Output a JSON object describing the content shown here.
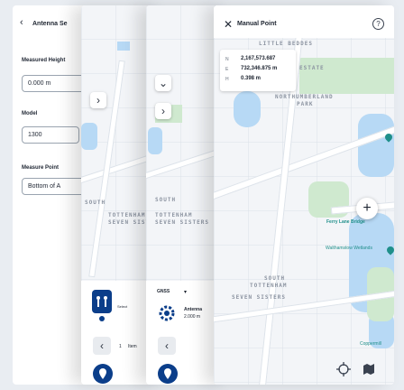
{
  "panel_a": {
    "title": "Antenna Se",
    "measured_height_label": "Measured Height",
    "measured_height_value": "0.000 m",
    "model_label": "Model",
    "model_value": "1300",
    "measure_point_label": "Measure Point",
    "measure_point_value": "Bottom of A",
    "bottom_device_label": "Select",
    "bottom_counter": "1",
    "bottom_counter_suffix": "Item"
  },
  "panel_b": {
    "map_labels": [
      "SOUTH",
      "TOTTENHAM",
      "SEVEN SISTERS"
    ]
  },
  "panel_c": {
    "gnss_label": "GNSS",
    "antenna_label": "Antenna",
    "antenna_value": "2.000 m",
    "map_labels": [
      "SOUTH",
      "TOTTENHAM",
      "SEVEN SISTERS"
    ]
  },
  "manual_point": {
    "title": "Manual Point",
    "coords": [
      {
        "axis": "N",
        "value": "2,167,573.687"
      },
      {
        "axis": "E",
        "value": "732,346.875 m"
      },
      {
        "axis": "H",
        "value": "0.398 m"
      }
    ],
    "map_labels": {
      "area1": "ESTATE",
      "area2": "NORTHUMBERLAND",
      "area3": "PARK",
      "top": "LITTLE BEDDES",
      "bottom1": "SOUTH",
      "bottom2": "TOTTENHAM",
      "bottom3": "SEVEN SISTERS",
      "poi1": "Ferry Lane Bridge",
      "poi2": "Walthamstow Wetlands",
      "poi3": "Coppermill"
    }
  },
  "colors": {
    "accent": "#0b3e8a",
    "water": "#b7d9f5",
    "park": "#cfe9cf",
    "poi": "#1f8f8a"
  }
}
